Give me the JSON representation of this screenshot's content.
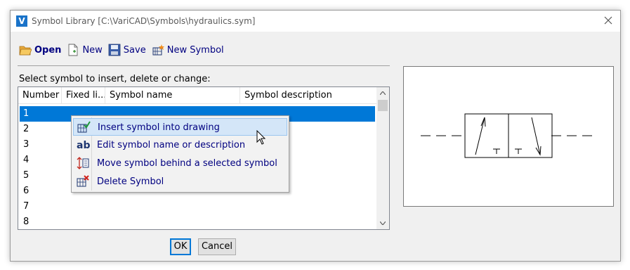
{
  "window": {
    "title": "Symbol Library [C:\\VariCAD\\Symbols\\hydraulics.sym]",
    "app_icon_letter": "V"
  },
  "toolbar": {
    "open_label": "Open",
    "new_label": "New",
    "save_label": "Save",
    "new_symbol_label": "New Symbol"
  },
  "prompt": "Select symbol to insert, delete or change:",
  "list": {
    "columns": [
      "Number",
      "Fixed li...",
      "Symbol name",
      "Symbol description"
    ],
    "rows": [
      "1",
      "2",
      "3",
      "4",
      "5",
      "6",
      "7",
      "8"
    ],
    "selected_row": "1"
  },
  "context_menu": {
    "items": [
      {
        "label": "Insert symbol into drawing",
        "icon": "insert-symbol-icon",
        "hovered": true
      },
      {
        "label": "Edit symbol name or description",
        "icon": "ab-text-icon"
      },
      {
        "label": "Move symbol behind a selected symbol",
        "icon": "move-order-icon"
      },
      {
        "label": "Delete Symbol",
        "icon": "delete-symbol-icon"
      }
    ]
  },
  "buttons": {
    "ok_label": "OK",
    "cancel_label": "Cancel"
  },
  "colors": {
    "selection": "#0078d7",
    "menu_hover": "#d4e6f8",
    "menu_text": "#000080"
  }
}
